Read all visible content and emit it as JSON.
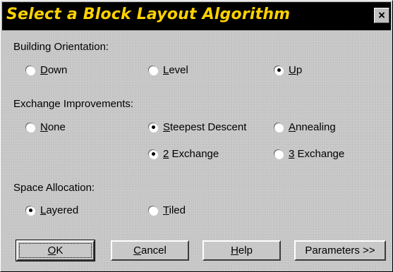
{
  "window": {
    "title": "Select a Block Layout Algorithm",
    "close_glyph": "×",
    "title_color": "#ffd200",
    "titlebar_color": "#000000"
  },
  "building_orientation": {
    "label": "Building Orientation:",
    "options": [
      {
        "mnemonic": "D",
        "rest": "own",
        "selected": false
      },
      {
        "mnemonic": "L",
        "rest": "evel",
        "selected": false
      },
      {
        "mnemonic": "U",
        "rest": "p",
        "selected": true
      }
    ]
  },
  "exchange_improvements": {
    "label": "Exchange Improvements:",
    "options": [
      {
        "mnemonic": "N",
        "rest": "one",
        "selected": false
      },
      {
        "mnemonic": "S",
        "rest": "teepest Descent",
        "selected": true
      },
      {
        "mnemonic": "A",
        "rest": "nnealing",
        "selected": false
      },
      {
        "mnemonic": "2",
        "rest": " Exchange",
        "selected": true
      },
      {
        "mnemonic": "3",
        "rest": " Exchange",
        "selected": false
      }
    ]
  },
  "space_allocation": {
    "label": "Space Allocation:",
    "options": [
      {
        "mnemonic": "L",
        "rest": "ayered",
        "selected": true
      },
      {
        "mnemonic": "T",
        "rest": "iled",
        "selected": false
      }
    ]
  },
  "buttons": {
    "ok": {
      "mnemonic": "O",
      "rest": "K"
    },
    "cancel": {
      "mnemonic": "C",
      "rest": "ancel"
    },
    "help": {
      "mnemonic": "H",
      "rest": "elp"
    },
    "parameters": "Parameters >>"
  }
}
